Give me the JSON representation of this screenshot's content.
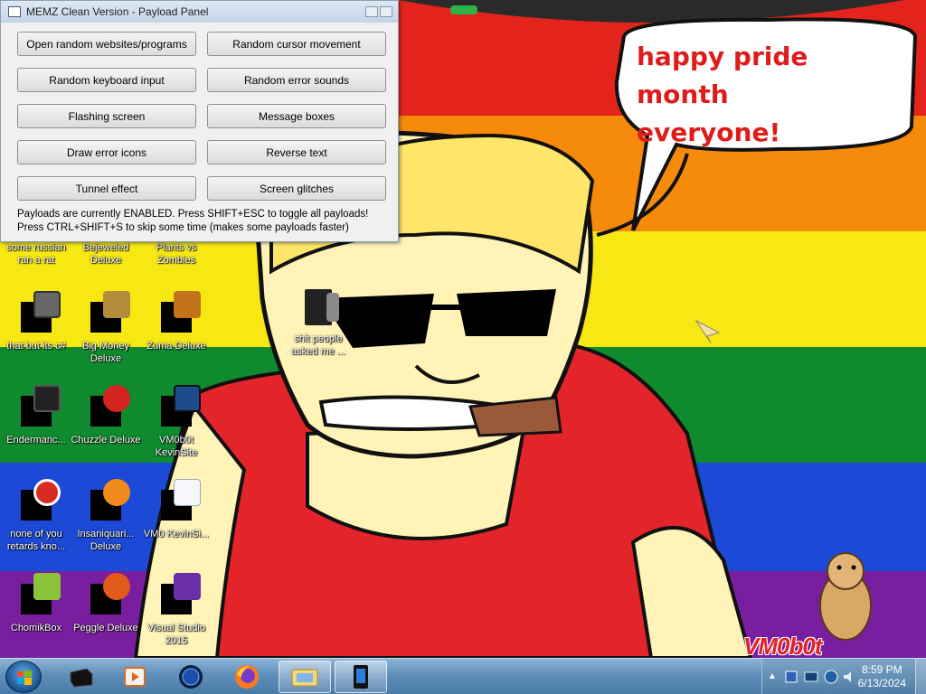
{
  "window": {
    "title": "MEMZ Clean Version - Payload Panel",
    "buttons": [
      "Open random websites/programs",
      "Random cursor movement",
      "Random keyboard input",
      "Random error sounds",
      "Flashing screen",
      "Message boxes",
      "Draw error icons",
      "Reverse text",
      "Tunnel effect",
      "Screen glitches"
    ],
    "status_line1": "Payloads are currently ENABLED. Press SHIFT+ESC to toggle all payloads!",
    "status_line2": "Press CTRL+SHIFT+S to skip some time (makes some payloads faster)"
  },
  "desktop_icons": [
    {
      "label": "some russian ran a rat",
      "icon": "file-icon"
    },
    {
      "label": "Bejeweled Deluxe",
      "icon": "gem-icon"
    },
    {
      "label": "Plants vs Zombies",
      "icon": "plant-icon"
    },
    {
      "label": "that but its c#",
      "icon": "stack-icon"
    },
    {
      "label": "Big Money Deluxe",
      "icon": "money-bag-icon"
    },
    {
      "label": "Zuma Deluxe",
      "icon": "frog-idol-icon"
    },
    {
      "label": "shit people asked me ...",
      "icon": "folder-icon"
    },
    {
      "label": "Endermanc...",
      "icon": "console-icon"
    },
    {
      "label": "Chuzzle Deluxe",
      "icon": "chuzzle-icon"
    },
    {
      "label": "VM0b0t KevinSite",
      "icon": "monitor-icon"
    },
    {
      "label": "none of you retards kno...",
      "icon": "circle-app-icon"
    },
    {
      "label": "Insaniquari... Deluxe",
      "icon": "fish-icon"
    },
    {
      "label": "VM0 KevinSi...",
      "icon": "document-icon"
    },
    {
      "label": "ChomikBox",
      "icon": "hamster-box-icon"
    },
    {
      "label": "Peggle Deluxe",
      "icon": "peggle-icon"
    },
    {
      "label": "Visual Studio 2015",
      "icon": "visual-studio-icon"
    }
  ],
  "speech_bubble": {
    "line1": "happy pride month",
    "line2": "everyone!"
  },
  "brand": "VM0b0t",
  "taskbar": {
    "apps": [
      "terminal-icon",
      "media-player-icon",
      "globe-icon",
      "firefox-icon",
      "explorer-icon",
      "window-app-icon"
    ],
    "clock_time": "8:59 PM",
    "clock_date": "6/13/2024"
  },
  "colors": {
    "stripe_red": "#e3241c",
    "stripe_orange": "#f58a0b",
    "stripe_yellow": "#f7e813",
    "stripe_green": "#0f8a2e",
    "stripe_blue": "#1c49d6",
    "stripe_purple": "#7a1ea0",
    "bubble_text": "#e01b1b"
  }
}
